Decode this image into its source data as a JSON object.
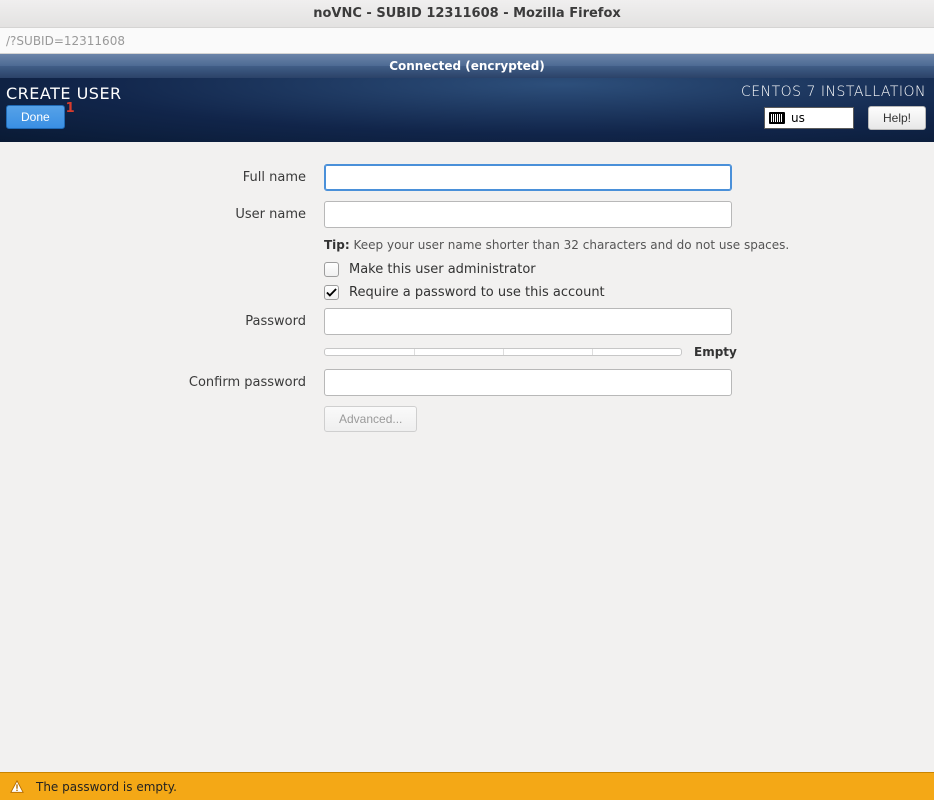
{
  "window": {
    "title": "noVNC - SUBID 12311608 - Mozilla Firefox"
  },
  "urlbar": {
    "text": "/?SUBID=12311608"
  },
  "vnc": {
    "status": "Connected (encrypted)"
  },
  "header": {
    "title": "CREATE USER",
    "done_label": "Done",
    "done_badge": "1",
    "brand": "CENTOS 7 INSTALLATION",
    "kb_layout": "us",
    "help_label": "Help!"
  },
  "form": {
    "fullname_label": "Full name",
    "fullname_value": "",
    "username_label": "User name",
    "username_value": "",
    "tip_prefix": "Tip:",
    "tip_text": " Keep your user name shorter than 32 characters and do not use spaces.",
    "admin_label": "Make this user administrator",
    "admin_checked": false,
    "reqpw_label": "Require a password to use this account",
    "reqpw_checked": true,
    "password_label": "Password",
    "password_value": "",
    "strength_label": "Empty",
    "confirm_label": "Confirm password",
    "confirm_value": "",
    "advanced_label": "Advanced..."
  },
  "warning": {
    "text": "The password is empty."
  }
}
